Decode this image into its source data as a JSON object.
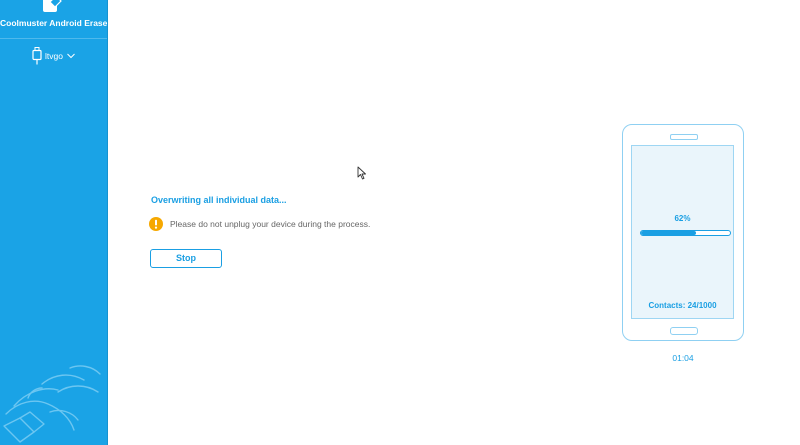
{
  "sidebar": {
    "app_title": "Coolmuster Android Eraser",
    "device_name": "ltvgo",
    "icons": [
      "eraser-logo-icon",
      "usb-icon",
      "chevron-down-icon"
    ]
  },
  "main": {
    "status_title": "Overwriting all individual data...",
    "warning_text": "Please do not unplug your device during the process.",
    "stop_label": "Stop"
  },
  "phone": {
    "progress_text": "62%",
    "progress_value": 62,
    "contacts_text": "Contacts: 24/1000",
    "elapsed_time": "01:04"
  },
  "colors": {
    "accent": "#1a9fe3",
    "sidebar": "#1aa3e6",
    "warning": "#f6a800"
  }
}
